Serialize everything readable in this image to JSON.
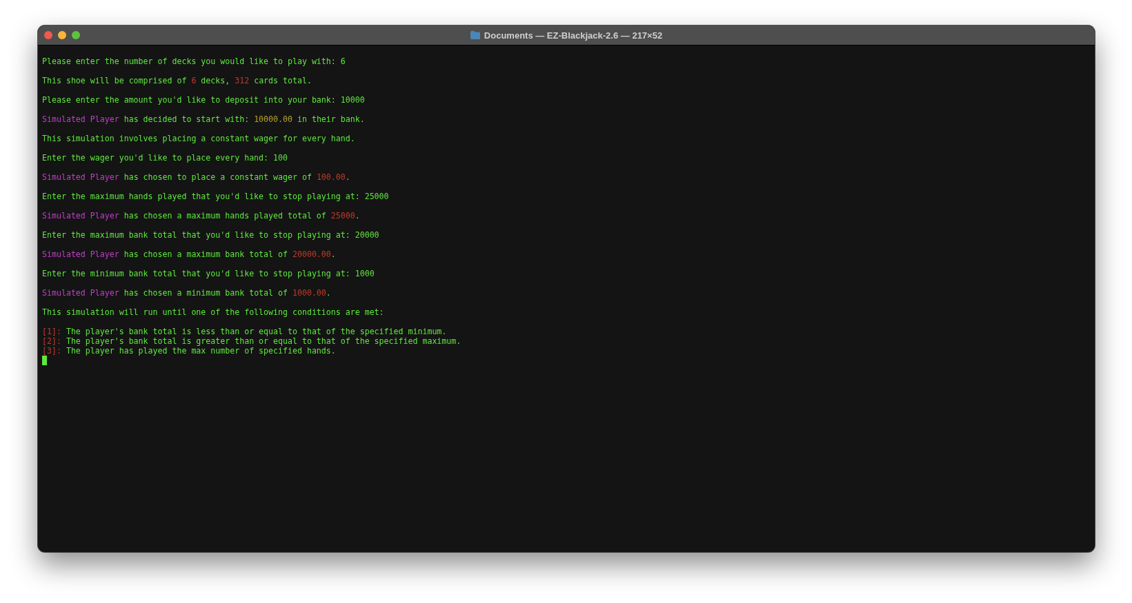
{
  "window": {
    "title": "Documents — EZ-Blackjack-2.6 — 217×52"
  },
  "blocks": [
    [
      {
        "color": "#5ee83e",
        "parts": [
          {
            "text": "Please enter the number of decks you would like to play with: 6"
          }
        ]
      }
    ],
    [
      {
        "color": "#5ee83e",
        "parts": [
          {
            "text": "This shoe will be comprised of "
          },
          {
            "text": "6",
            "color": "#c23a2a"
          },
          {
            "text": " decks, "
          },
          {
            "text": "312",
            "color": "#c23a2a"
          },
          {
            "text": " cards total."
          }
        ]
      }
    ],
    [
      {
        "color": "#5ee83e",
        "parts": [
          {
            "text": "Please enter the amount you'd like to deposit into your bank: 10000"
          }
        ]
      }
    ],
    [
      {
        "color": "#5ee83e",
        "parts": [
          {
            "text": "Simulated Player",
            "color": "#c03ec8"
          },
          {
            "text": " has decided to start with: "
          },
          {
            "text": "10000.00",
            "color": "#b8a22a"
          },
          {
            "text": " in their bank."
          }
        ]
      }
    ],
    [
      {
        "color": "#5ee83e",
        "parts": [
          {
            "text": "This simulation involves placing a constant wager for every hand."
          }
        ]
      }
    ],
    [
      {
        "color": "#5ee83e",
        "parts": [
          {
            "text": "Enter the wager you'd like to place every hand: 100"
          }
        ]
      }
    ],
    [
      {
        "color": "#5ee83e",
        "parts": [
          {
            "text": "Simulated Player",
            "color": "#c03ec8"
          },
          {
            "text": " has chosen to place a constant wager of "
          },
          {
            "text": "100.00",
            "color": "#c23a2a"
          },
          {
            "text": "."
          }
        ]
      }
    ],
    [
      {
        "color": "#5ee83e",
        "parts": [
          {
            "text": "Enter the maximum hands played that you'd like to stop playing at: 25000"
          }
        ]
      }
    ],
    [
      {
        "color": "#5ee83e",
        "parts": [
          {
            "text": "Simulated Player",
            "color": "#c03ec8"
          },
          {
            "text": " has chosen a maximum hands played total of "
          },
          {
            "text": "25000",
            "color": "#c23a2a"
          },
          {
            "text": "."
          }
        ]
      }
    ],
    [
      {
        "color": "#5ee83e",
        "parts": [
          {
            "text": "Enter the maximum bank total that you'd like to stop playing at: 20000"
          }
        ]
      }
    ],
    [
      {
        "color": "#5ee83e",
        "parts": [
          {
            "text": "Simulated Player",
            "color": "#c03ec8"
          },
          {
            "text": " has chosen a maximum bank total of "
          },
          {
            "text": "20000.00",
            "color": "#c23a2a"
          },
          {
            "text": "."
          }
        ]
      }
    ],
    [
      {
        "color": "#5ee83e",
        "parts": [
          {
            "text": "Enter the minimum bank total that you'd like to stop playing at: 1000"
          }
        ]
      }
    ],
    [
      {
        "color": "#5ee83e",
        "parts": [
          {
            "text": "Simulated Player",
            "color": "#c03ec8"
          },
          {
            "text": " has chosen a minimum bank total of "
          },
          {
            "text": "1000.00",
            "color": "#c23a2a"
          },
          {
            "text": "."
          }
        ]
      }
    ],
    [
      {
        "color": "#5ee83e",
        "parts": [
          {
            "text": "This simulation will run until one of the following conditions are met:"
          }
        ]
      }
    ],
    [
      {
        "color": "#5ee83e",
        "parts": [
          {
            "text": "[1]:",
            "color": "#c23a2a"
          },
          {
            "text": " The player's bank total is less than or equal to that of the specified minimum."
          }
        ]
      },
      {
        "color": "#5ee83e",
        "parts": [
          {
            "text": "[2]:",
            "color": "#c23a2a"
          },
          {
            "text": " The player's bank total is greater than or equal to that of the specified maximum."
          }
        ]
      },
      {
        "color": "#5ee83e",
        "parts": [
          {
            "text": "[3]:",
            "color": "#c23a2a"
          },
          {
            "text": " The player has played the max number of specified hands."
          }
        ]
      }
    ]
  ],
  "cursor": {
    "color": "#5ee83e"
  }
}
